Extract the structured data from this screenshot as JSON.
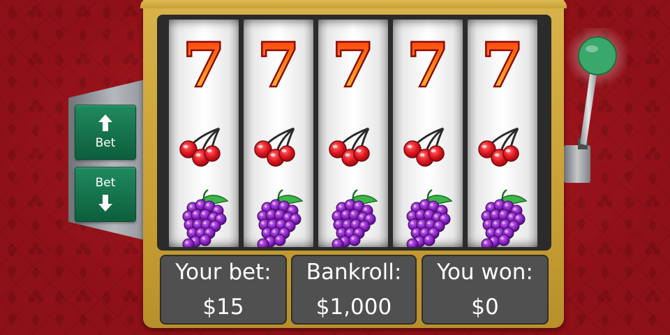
{
  "bet_controls": {
    "up_label": "Bet",
    "down_label": "Bet",
    "up_icon": "arrow-up-icon",
    "down_icon": "arrow-down-icon"
  },
  "reels": [
    {
      "symbols": [
        "seven",
        "cherry",
        "grapes"
      ]
    },
    {
      "symbols": [
        "seven",
        "cherry",
        "grapes"
      ]
    },
    {
      "symbols": [
        "seven",
        "cherry",
        "grapes"
      ]
    },
    {
      "symbols": [
        "seven",
        "cherry",
        "grapes"
      ]
    },
    {
      "symbols": [
        "seven",
        "cherry",
        "grapes"
      ]
    }
  ],
  "seven_text": "7",
  "info": {
    "bet_title": "Your bet:",
    "bet_value": "$15",
    "bankroll_title": "Bankroll:",
    "bankroll_value": "$1,000",
    "won_title": "You won:",
    "won_value": "$0"
  },
  "colors": {
    "background": "#a3151e",
    "cabinet": "#c9a035",
    "button": "#0d5e3c",
    "lever_knob": "#3aa86a"
  }
}
